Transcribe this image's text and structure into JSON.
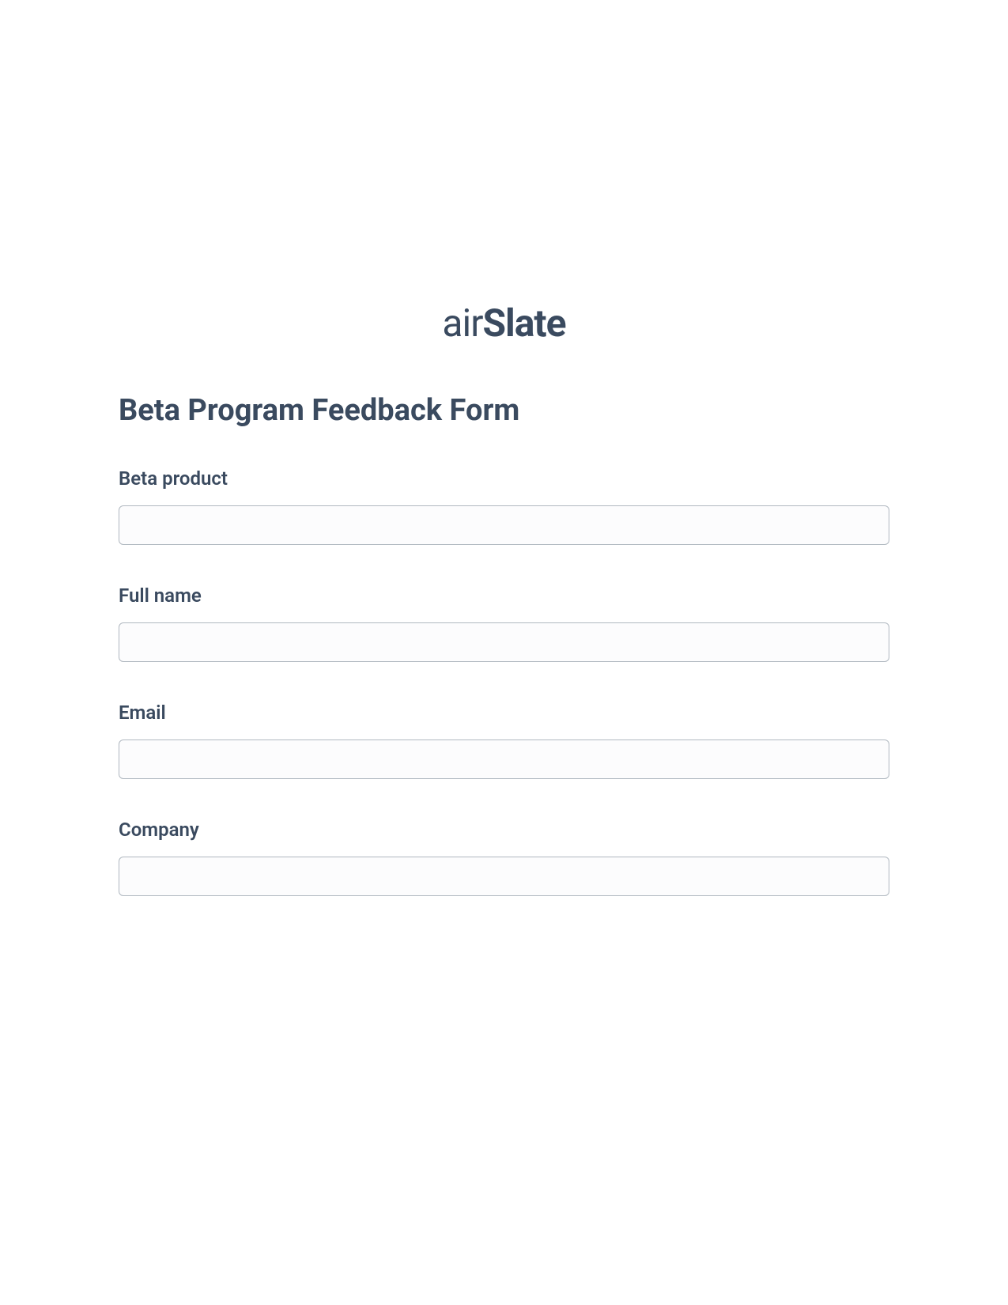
{
  "logo": {
    "part1": "air",
    "part2": "Slate"
  },
  "form": {
    "title": "Beta Program Feedback Form",
    "fields": [
      {
        "label": "Beta product",
        "value": ""
      },
      {
        "label": "Full name",
        "value": ""
      },
      {
        "label": "Email",
        "value": ""
      },
      {
        "label": "Company",
        "value": ""
      }
    ]
  }
}
